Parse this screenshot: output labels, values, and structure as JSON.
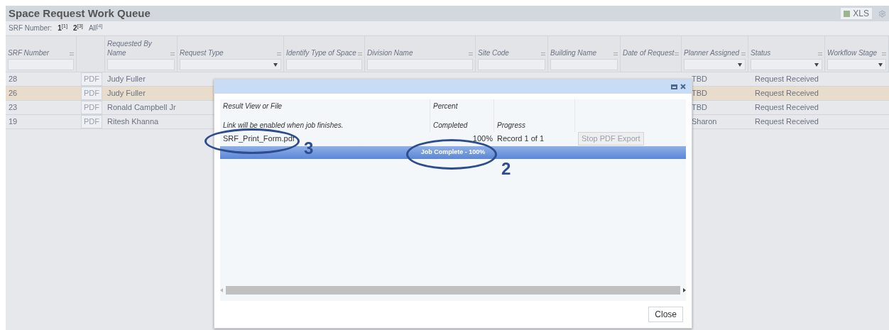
{
  "page": {
    "title": "Space Request Work Queue",
    "export_label": "XLS"
  },
  "srf_filter": {
    "label": "SRF Number:",
    "options": [
      {
        "label": "1",
        "count": "[1]",
        "selected": false
      },
      {
        "label": "2",
        "count": "[3]",
        "selected": false
      },
      {
        "label": "All",
        "count": "[4]",
        "selected": true
      }
    ]
  },
  "table": {
    "columns": [
      {
        "label": "SRF Number",
        "kind": "text"
      },
      {
        "kind": "none"
      },
      {
        "label": "Requested By Name",
        "kind": "text"
      },
      {
        "label": "Request Type",
        "kind": "select"
      },
      {
        "label": "Identify Type of Space",
        "kind": "text"
      },
      {
        "label": "Division Name",
        "kind": "text"
      },
      {
        "label": "Site Code",
        "kind": "text"
      },
      {
        "label": "Building Name",
        "kind": "text"
      },
      {
        "label": "Date of Request",
        "kind": "none"
      },
      {
        "label": "Planner Assigned",
        "kind": "select"
      },
      {
        "label": "Status",
        "kind": "select"
      },
      {
        "label": "Workflow Stage",
        "kind": "select"
      }
    ],
    "rows": [
      {
        "srf": "28",
        "pdf": "PDF",
        "name": "Judy Fuller",
        "planner": "TBD",
        "status": "Request Received",
        "selected": false
      },
      {
        "srf": "26",
        "pdf": "PDF",
        "name": "Judy Fuller",
        "planner": "TBD",
        "status": "Request Received",
        "selected": true
      },
      {
        "srf": "23",
        "pdf": "PDF",
        "name": "Ronald Campbell Jr",
        "planner": "TBD",
        "status": "Request Received",
        "selected": false
      },
      {
        "srf": "19",
        "pdf": "PDF",
        "name": "Ritesh Khanna",
        "planner": "Sharon",
        "status": "Request Received",
        "selected": false
      }
    ]
  },
  "dialog": {
    "columns": [
      {
        "line1": "Result View or File",
        "line2": "Link will be enabled when job finishes."
      },
      {
        "line1": "Percent",
        "line2": "Completed"
      },
      {
        "line2": "Progress"
      }
    ],
    "file": "SRF_Print_Form.pdf",
    "percent": "100%",
    "progress": "Record 1 of 1",
    "stop_button": "Stop PDF Export",
    "stop_disabled": true,
    "bar_label": "Job Complete - 100%",
    "level": 1,
    "close_button": "Close"
  },
  "annotations": [
    {
      "label": "3"
    },
    {
      "label": "2"
    }
  ]
}
